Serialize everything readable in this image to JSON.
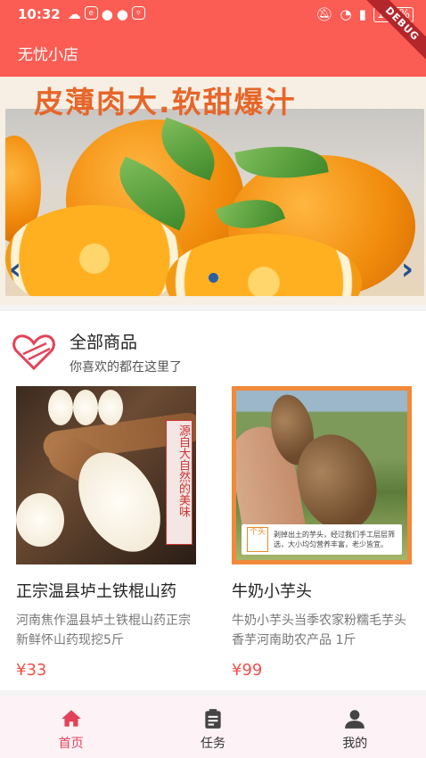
{
  "status_bar": {
    "time": "10:32",
    "battery": "100%"
  },
  "app_bar": {
    "title": "无忧小店"
  },
  "banner": {
    "headline": "皮薄肉大.软甜爆汁",
    "left_arrow": "‹",
    "right_arrow": "›",
    "active_dot_index": 0,
    "dot_count": 1
  },
  "section": {
    "title": "全部商品",
    "subtitle": "你喜欢的都在这里了"
  },
  "products": [
    {
      "name": "正宗温县垆土铁棍山药",
      "description": "河南焦作温县垆土铁棍山药正宗新鲜怀山药现挖5斤",
      "price": "¥33",
      "image_label": "源自大自然的美味"
    },
    {
      "name": "牛奶小芋头",
      "description": "牛奶小芋头当季农家粉糯毛芋头香芋河南助农产品 1斤",
      "price": "¥99",
      "image_caption": "剥掉出土的芋头，经过我们手工层层筛选，大小均匀营养丰富，老少皆宜。",
      "image_badge": "个头"
    }
  ],
  "tabs": [
    {
      "label": "首页",
      "icon": "home-icon",
      "active": true
    },
    {
      "label": "任务",
      "icon": "clipboard-icon",
      "active": false
    },
    {
      "label": "我的",
      "icon": "person-icon",
      "active": false
    }
  ],
  "colors": {
    "primary": "#fb5c53",
    "price": "#f24f4a",
    "tab_active": "#e3435a",
    "tab_bar_bg": "#fdf2f6"
  }
}
